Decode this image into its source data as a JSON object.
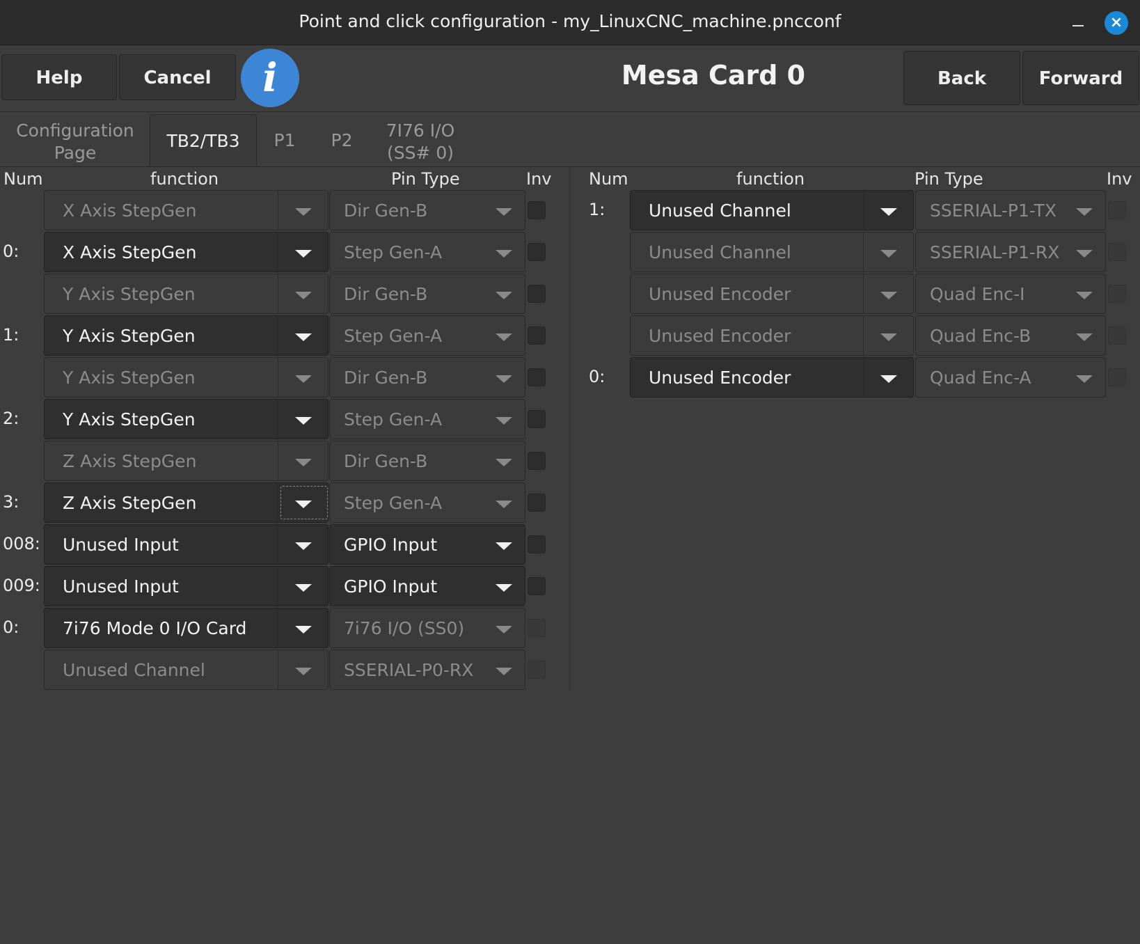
{
  "window": {
    "title": "Point and click configuration - my_LinuxCNC_machine.pncconf",
    "close_icon": "×"
  },
  "toolbar": {
    "help": "Help",
    "cancel": "Cancel",
    "info_icon": "i",
    "heading": "Mesa Card 0",
    "back": "Back",
    "forward": "Forward"
  },
  "tabs": [
    {
      "line1": "Configuration",
      "line2": "Page"
    },
    {
      "line1": "TB2/TB3",
      "line2": ""
    },
    {
      "line1": "P1",
      "line2": ""
    },
    {
      "line1": "P2",
      "line2": ""
    },
    {
      "line1": "7I76 I/O",
      "line2": "(SS# 0)"
    }
  ],
  "headers": {
    "num": "Num",
    "function": "function",
    "pin_type": "Pin Type",
    "inv": "Inv"
  },
  "left_rows": [
    {
      "num": "",
      "function": "X Axis StepGen",
      "pin_type": "Dir Gen-B",
      "func_active": false,
      "pin_active": false
    },
    {
      "num": "0:",
      "function": "X Axis StepGen",
      "pin_type": "Step Gen-A",
      "func_active": true,
      "pin_active": false
    },
    {
      "num": "",
      "function": "Y Axis StepGen",
      "pin_type": "Dir Gen-B",
      "func_active": false,
      "pin_active": false
    },
    {
      "num": "1:",
      "function": "Y Axis StepGen",
      "pin_type": "Step Gen-A",
      "func_active": true,
      "pin_active": false
    },
    {
      "num": "",
      "function": "Y Axis StepGen",
      "pin_type": "Dir Gen-B",
      "func_active": false,
      "pin_active": false
    },
    {
      "num": "2:",
      "function": "Y Axis StepGen",
      "pin_type": "Step Gen-A",
      "func_active": true,
      "pin_active": false
    },
    {
      "num": "",
      "function": "Z Axis StepGen",
      "pin_type": "Dir Gen-B",
      "func_active": false,
      "pin_active": false
    },
    {
      "num": "3:",
      "function": "Z Axis StepGen",
      "pin_type": "Step Gen-A",
      "func_active": true,
      "pin_active": false
    },
    {
      "num": "008:",
      "function": "Unused Input",
      "pin_type": "GPIO Input",
      "func_active": true,
      "pin_active": true
    },
    {
      "num": "009:",
      "function": "Unused Input",
      "pin_type": "GPIO Input",
      "func_active": true,
      "pin_active": true
    },
    {
      "num": "0:",
      "function": "7i76 Mode 0 I/O Card",
      "pin_type": "7i76 I/O (SS0)",
      "func_active": true,
      "pin_active": false
    },
    {
      "num": "",
      "function": "Unused Channel",
      "pin_type": "SSERIAL-P0-RX",
      "func_active": false,
      "pin_active": false
    }
  ],
  "right_rows": [
    {
      "num": "1:",
      "function": "Unused Channel",
      "pin_type": "SSERIAL-P1-TX",
      "func_active": true,
      "pin_active": false
    },
    {
      "num": "",
      "function": "Unused Channel",
      "pin_type": "SSERIAL-P1-RX",
      "func_active": false,
      "pin_active": false
    },
    {
      "num": "",
      "function": "Unused Encoder",
      "pin_type": "Quad Enc-I",
      "func_active": false,
      "pin_active": false
    },
    {
      "num": "",
      "function": "Unused Encoder",
      "pin_type": "Quad Enc-B",
      "func_active": false,
      "pin_active": false
    },
    {
      "num": "0:",
      "function": "Unused Encoder",
      "pin_type": "Quad Enc-A",
      "func_active": true,
      "pin_active": false
    }
  ]
}
